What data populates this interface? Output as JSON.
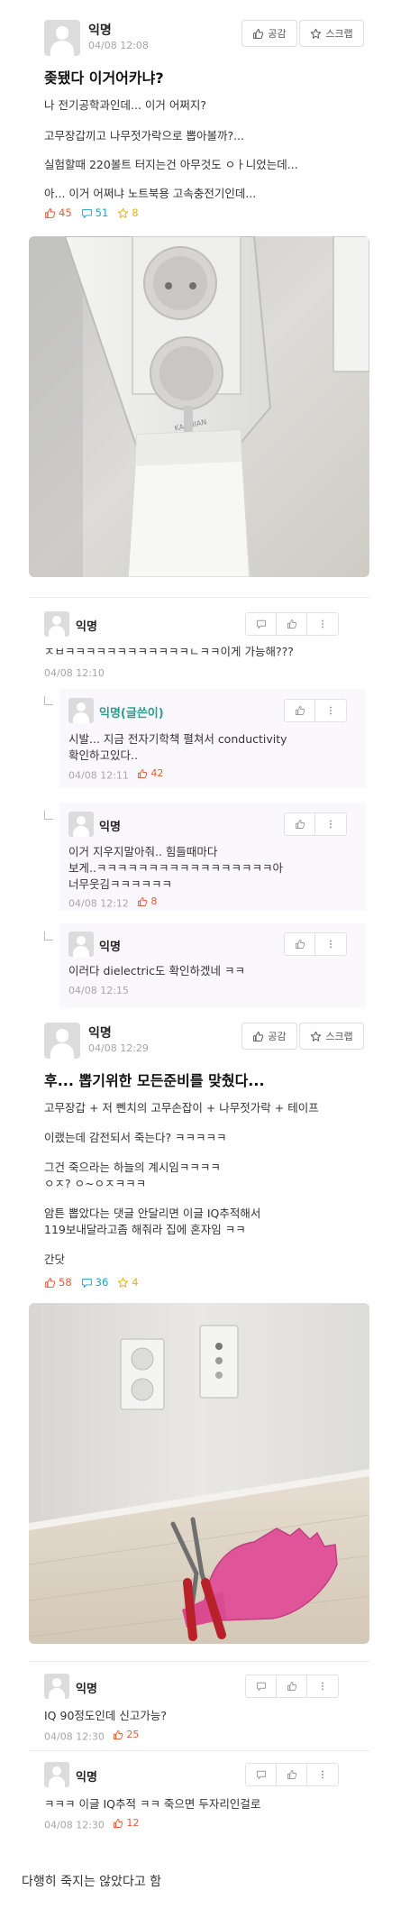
{
  "post1": {
    "author": "익명",
    "date": "04/08 12:08",
    "like_btn": "공감",
    "scrap_btn": "스크랩",
    "title": "좆됐다 이거어카냐?",
    "lines": [
      "나 전기공학과인데... 이거 어쩌지?",
      "고무장갑끼고 나무젓가락으로 뽑아볼까?...",
      "실험할때 220볼트 터지는건 아무것도 ㅇㅏ니었는데...",
      "아... 이거 어쩌냐 노트북용 고속충전기인데..."
    ],
    "likes": "45",
    "comments": "51",
    "scraps": "8",
    "photo_brand": "KAEMIAN"
  },
  "comments1": [
    {
      "author": "익명",
      "text": "ㅈㅂㅋㅋㅋㅋㅋㅋㅋㅋㅋㅋㅋㅋㄴㅋㅋ이게 가능해???",
      "date": "04/08 12:10",
      "likes": ""
    }
  ],
  "replies1": [
    {
      "author": "익명(글쓴이)",
      "lines": [
        "시발... 지금 전자기학책 펼쳐서 conductivity",
        "확인하고있다.."
      ],
      "date": "04/08 12:11",
      "likes": "42"
    },
    {
      "author": "익명",
      "lines": [
        "이거 지우지말아줘.. 힘들때마다",
        "보게..ㅋㅋㅋㅋㅋㅋㅋㅋㅋㅋㅋㅋㅋㅋㅋㅋㅋ아",
        "너무웃김ㅋㅋㅋㅋㅋㅋ"
      ],
      "date": "04/08 12:12",
      "likes": "8"
    },
    {
      "author": "익명",
      "lines": [
        "이러다 dielectric도 확인하겠네 ㅋㅋ"
      ],
      "date": "04/08 12:15",
      "likes": ""
    }
  ],
  "post2": {
    "author": "익명",
    "date": "04/08 12:29",
    "like_btn": "공감",
    "scrap_btn": "스크랩",
    "title": "후... 뽑기위한 모든준비를 맞췄다...",
    "paragraphs": [
      [
        "고무장갑 + 저 뻰치의 고무손잡이 + 나무젓가락 + 테이프"
      ],
      [
        "이랬는데 감전되서 죽는다? ㅋㅋㅋㅋㅋ"
      ],
      [
        "그건 죽으라는 하늘의 계시임ㅋㅋㅋㅋ",
        "ㅇㅈ? ㅇ~ㅇㅈㅋㅋㅋ"
      ],
      [
        "암튼 뽑았다는 댓글 안달리면 이글 IQ추적해서",
        "119보내달라고좀 해줘라 집에 혼자임 ㅋㅋ"
      ],
      [
        "간닷"
      ]
    ],
    "likes": "58",
    "comments": "36",
    "scraps": "4"
  },
  "comments2": [
    {
      "author": "익명",
      "text": "IQ 90정도인데 신고가능?",
      "date": "04/08 12:30",
      "likes": "25"
    },
    {
      "author": "익명",
      "text": "ㅋㅋㅋ 이글 IQ추적 ㅋㅋ 죽으면 두자리인걸로",
      "date": "04/08 12:30",
      "likes": "12"
    }
  ],
  "footer_caption": "다행히 죽지는 않았다고 함",
  "colors": {
    "accent_green": "#2a9d8f",
    "like_red": "#e05c3a",
    "comment_teal": "#1aa4c2",
    "scrap_gold": "#e8b20e",
    "glove_pink": "#e0559a"
  },
  "icons": {
    "like": "thumbs-up-icon",
    "comment": "speech-bubble-icon",
    "scrap": "star-icon",
    "more": "more-vertical-icon",
    "reply": "reply-arrow-icon"
  }
}
